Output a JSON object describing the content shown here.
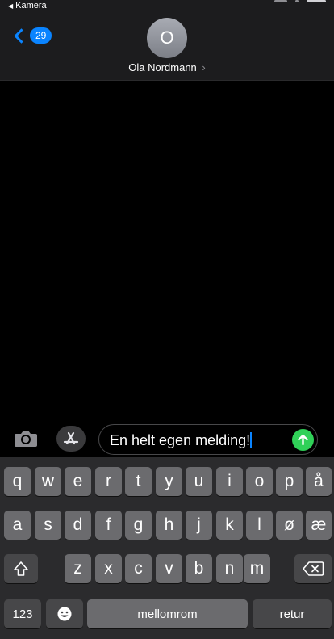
{
  "status_bar": {
    "back_app_label": "Kamera"
  },
  "header": {
    "back_count": "29",
    "avatar_initial": "O",
    "contact_name": "Ola Nordmann",
    "name_chevron": "›"
  },
  "compose": {
    "message_text": "En helt egen melding!"
  },
  "keyboard": {
    "row1": [
      "q",
      "w",
      "e",
      "r",
      "t",
      "y",
      "u",
      "i",
      "o",
      "p",
      "å"
    ],
    "row2": [
      "a",
      "s",
      "d",
      "f",
      "g",
      "h",
      "j",
      "k",
      "l",
      "ø",
      "æ"
    ],
    "row3": [
      "z",
      "x",
      "c",
      "v",
      "b",
      "n",
      "m"
    ],
    "numbers_label": "123",
    "space_label": "mellomrom",
    "return_label": "retur"
  },
  "colors": {
    "accent": "#0a84ff",
    "send": "#30d158",
    "key": "#6b6b6e",
    "key_dark": "#474749"
  }
}
